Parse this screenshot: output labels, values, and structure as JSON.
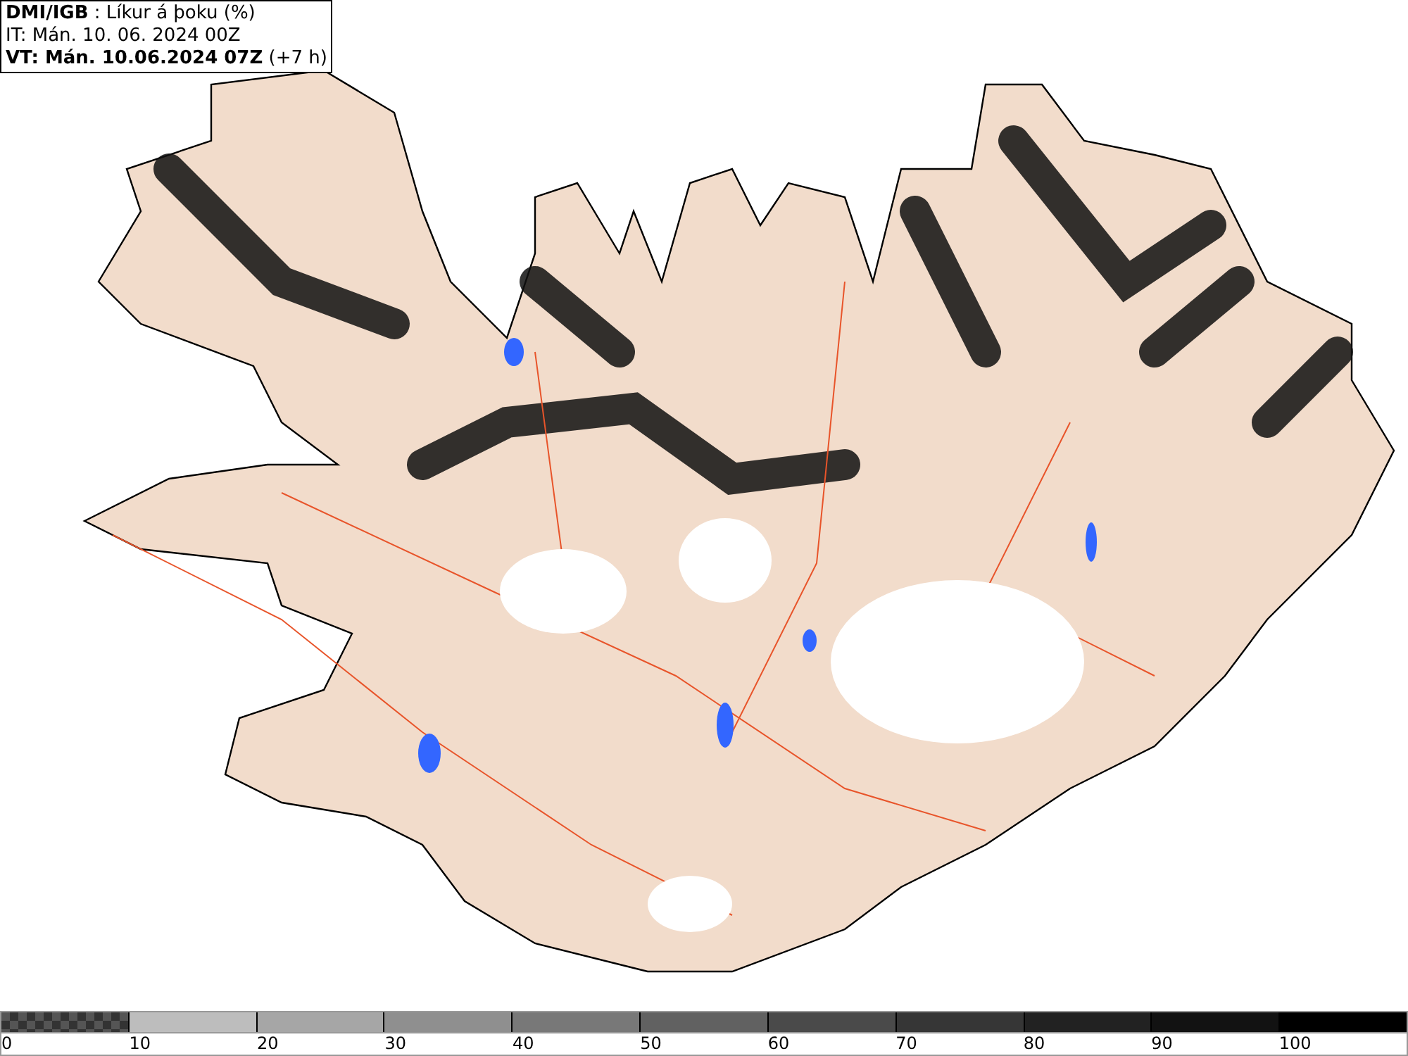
{
  "header": {
    "lines": [
      "**DMI/IGB** : Líkur á þoku (%)",
      "IT: Mán. 10. 06. 2024 00Z",
      "**VT: Mán. 10.06.2024 07Z** (+7 h)"
    ]
  },
  "legend": {
    "bins": [
      {
        "kind": "checker",
        "color": "#555555",
        "label": "0"
      },
      {
        "kind": "solid",
        "color": "#bdbdbd",
        "label": "10"
      },
      {
        "kind": "solid",
        "color": "#a6a6a6",
        "label": "20"
      },
      {
        "kind": "solid",
        "color": "#8f8f8f",
        "label": "30"
      },
      {
        "kind": "solid",
        "color": "#787878",
        "label": "40"
      },
      {
        "kind": "solid",
        "color": "#616161",
        "label": "50"
      },
      {
        "kind": "solid",
        "color": "#4a4a4a",
        "label": "60"
      },
      {
        "kind": "solid",
        "color": "#363636",
        "label": "70"
      },
      {
        "kind": "solid",
        "color": "#222222",
        "label": "80"
      },
      {
        "kind": "solid",
        "color": "#121212",
        "label": "90"
      },
      {
        "kind": "solid",
        "color": "#000000",
        "label": "100"
      }
    ]
  }
}
